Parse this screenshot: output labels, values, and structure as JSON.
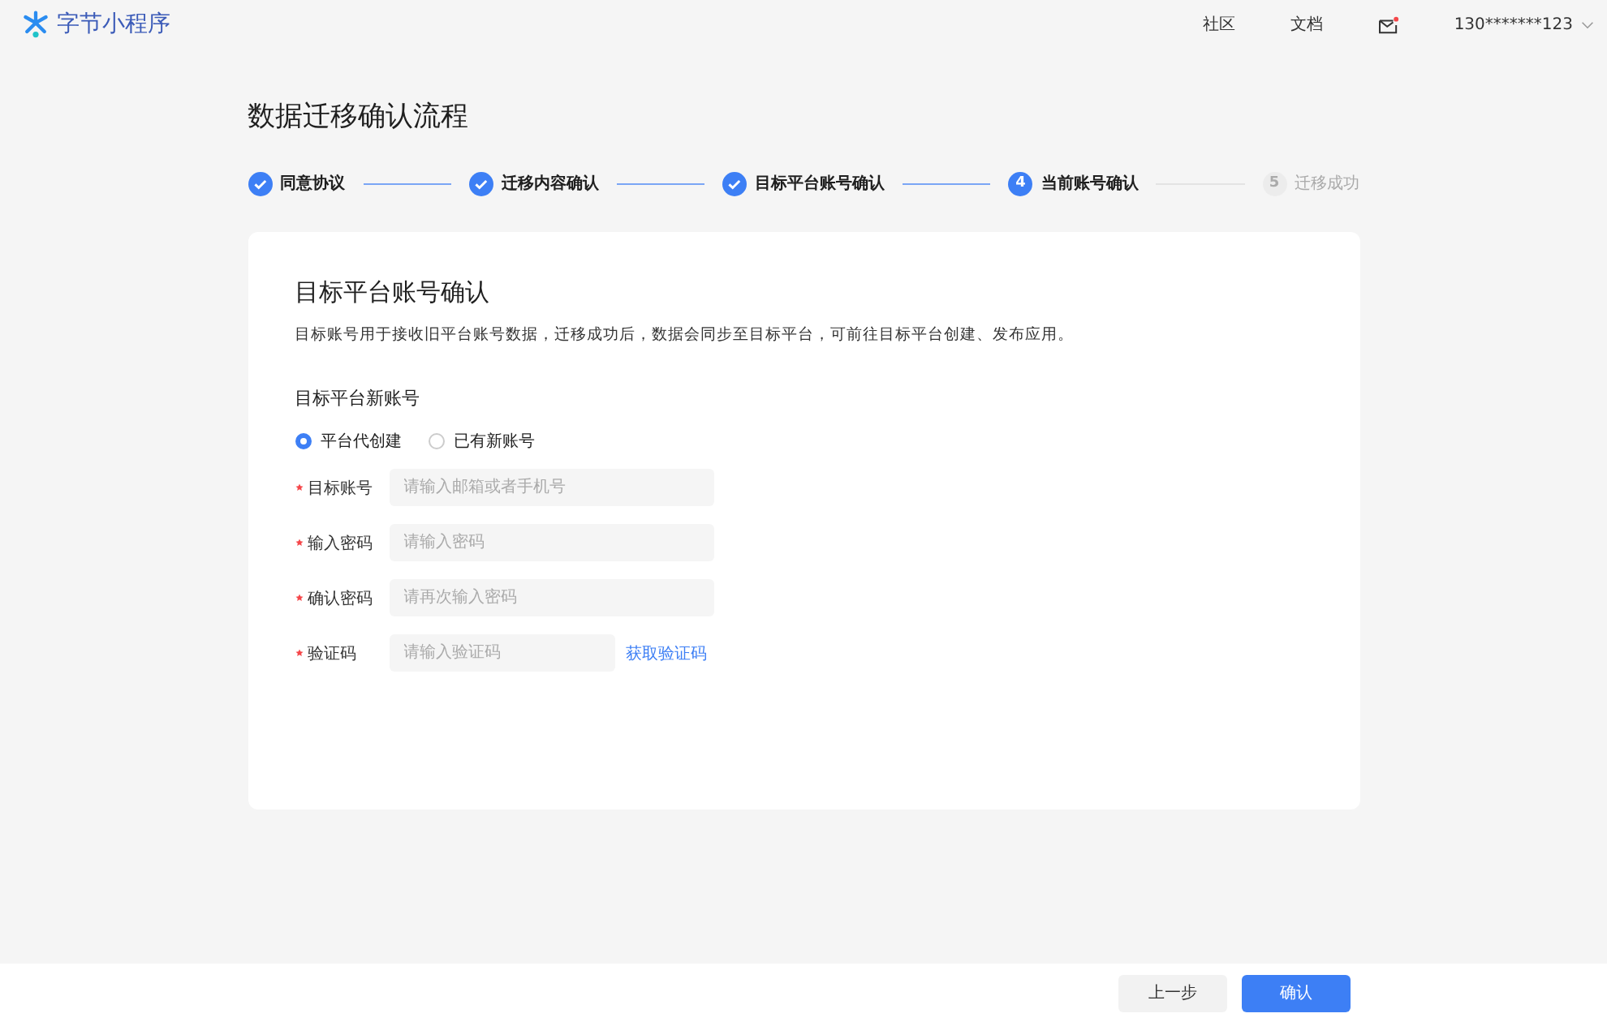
{
  "header": {
    "logo": "字节小程序",
    "nav": [
      "社区",
      "文档"
    ],
    "mail_unread": true,
    "account": "130*******123"
  },
  "page_title": "数据迁移确认流程",
  "steps": [
    {
      "kind": "done",
      "label": "同意协议"
    },
    {
      "kind": "done",
      "label": "迁移内容确认"
    },
    {
      "kind": "done",
      "label": "目标平台账号确认"
    },
    {
      "kind": "current",
      "number": "4",
      "label": "当前账号确认"
    },
    {
      "kind": "pending",
      "number": "5",
      "label": "迁移成功"
    }
  ],
  "card": {
    "title": "目标平台账号确认",
    "description": "目标账号用于接收旧平台账号数据，迁移成功后，数据会同步至目标平台，可前往目标平台创建、发布应用。",
    "section_title": "目标平台新账号",
    "options": [
      {
        "label": "平台代创建",
        "selected": true
      },
      {
        "label": "已有新账号",
        "selected": false
      }
    ],
    "fields": [
      {
        "kind": "text",
        "label": "目标账号",
        "required": true,
        "placeholder": "请输入邮箱或者手机号"
      },
      {
        "kind": "text",
        "label": "输入密码",
        "required": true,
        "placeholder": "请输入密码"
      },
      {
        "kind": "text",
        "label": "确认密码",
        "required": true,
        "placeholder": "请再次输入密码"
      },
      {
        "kind": "code",
        "label": "验证码",
        "required": true,
        "placeholder": "请输入验证码",
        "action": "获取验证码"
      }
    ]
  },
  "footer": {
    "back": "上一步",
    "confirm": "确认"
  }
}
